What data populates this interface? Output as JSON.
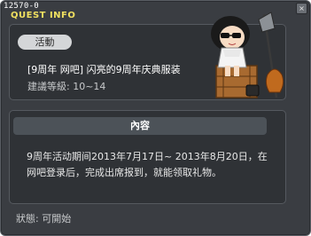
{
  "window": {
    "quest_id": "12570-0",
    "title": "QUEST INFO",
    "close_symbol": "×"
  },
  "quest": {
    "badge": "活動",
    "name": "[9周年 网吧] 闪亮的9周年庆典服装",
    "level": "建議等級: 10~14"
  },
  "content": {
    "header": "內容",
    "body": "9周年活动期间2013年7月17日~ 2013年8月20日，在网吧登录后，完成出席报到，就能领取礼物。"
  },
  "status": "狀態:  可開始",
  "icons": {
    "character": "character-illustration-icon",
    "close": "close-icon"
  },
  "colors": {
    "title": "#f0e060",
    "background": "#3a3d42",
    "panel": "#2f3236",
    "header": "#4c5258"
  }
}
